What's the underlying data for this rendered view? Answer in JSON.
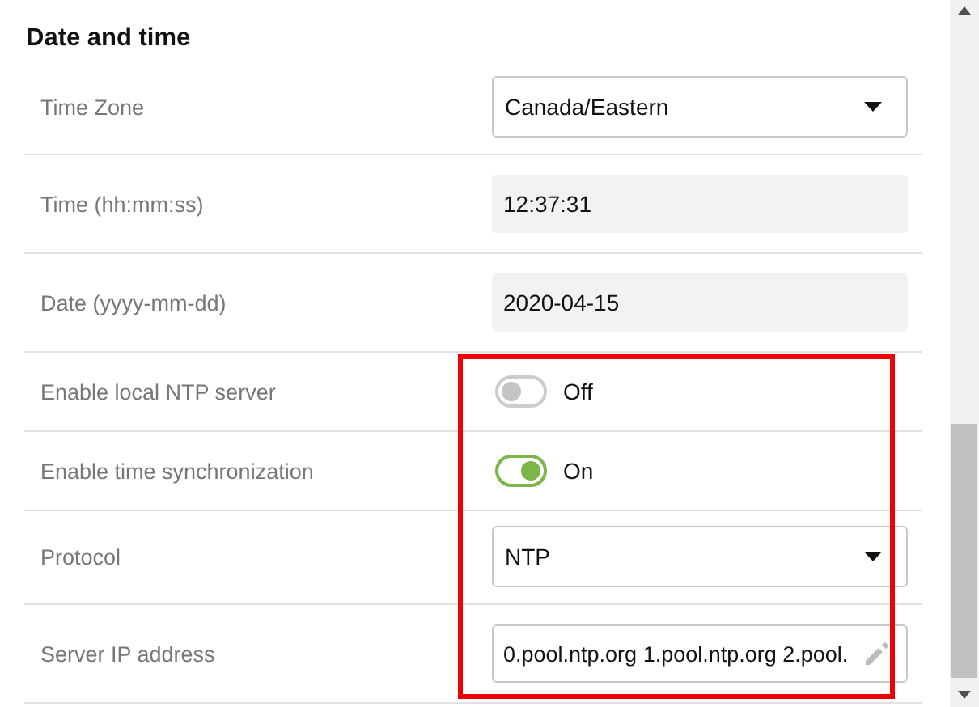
{
  "section": {
    "title": "Date and time"
  },
  "rows": [
    {
      "kind": "select",
      "label": "Time Zone",
      "value": "Canada/Eastern",
      "highlighted": false
    },
    {
      "kind": "readonly",
      "label": "Time (hh:mm:ss)",
      "value": "12:37:31",
      "highlighted": false
    },
    {
      "kind": "readonly",
      "label": "Date (yyyy-mm-dd)",
      "value": "2020-04-15",
      "highlighted": false
    },
    {
      "kind": "toggle",
      "label": "Enable local NTP server",
      "on": false,
      "state_text": "Off",
      "highlighted": true
    },
    {
      "kind": "toggle",
      "label": "Enable time synchronization",
      "on": true,
      "state_text": "On",
      "highlighted": true
    },
    {
      "kind": "select",
      "label": "Protocol",
      "value": "NTP",
      "highlighted": true
    },
    {
      "kind": "editable",
      "label": "Server IP address",
      "value": "0.pool.ntp.org 1.pool.ntp.org 2.pool.",
      "highlighted": true
    }
  ]
}
